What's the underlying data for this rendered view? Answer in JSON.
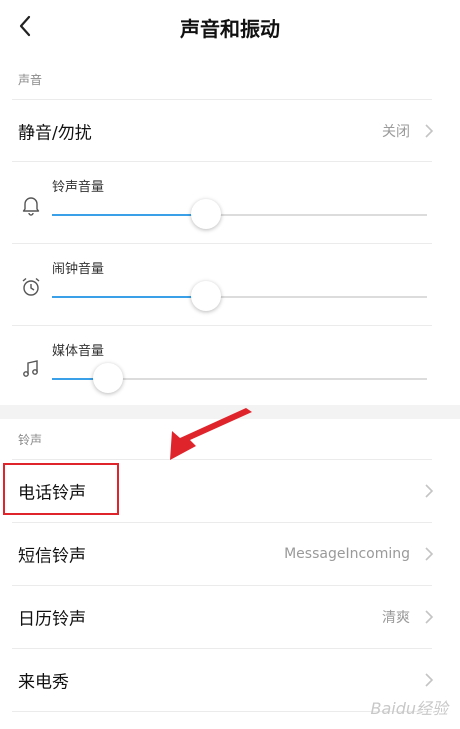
{
  "header": {
    "title": "声音和振动"
  },
  "sound_section": {
    "label": "声音",
    "silent_row": {
      "label": "静音/勿扰",
      "value": "关闭"
    },
    "volumes": [
      {
        "label": "铃声音量",
        "icon": "bell-icon",
        "level": 0.41
      },
      {
        "label": "闹钟音量",
        "icon": "alarm-clock-icon",
        "level": 0.41
      },
      {
        "label": "媒体音量",
        "icon": "music-note-icon",
        "level": 0.15
      }
    ]
  },
  "ringtone_section": {
    "label": "铃声",
    "rows": [
      {
        "label": "电话铃声",
        "value": ""
      },
      {
        "label": "短信铃声",
        "value": "MessageIncoming"
      },
      {
        "label": "日历铃声",
        "value": "清爽"
      },
      {
        "label": "来电秀",
        "value": ""
      }
    ]
  },
  "colors": {
    "accent": "#3aa0e8",
    "annotation": "#e0242c"
  },
  "watermark": "Baidu经验"
}
